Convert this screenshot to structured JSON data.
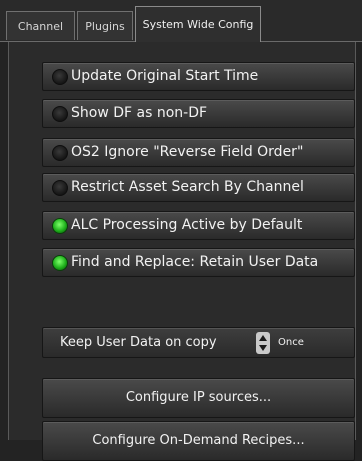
{
  "tabs": [
    {
      "label": "Channel"
    },
    {
      "label": "Plugins"
    },
    {
      "label": "System Wide Config"
    }
  ],
  "toggles": [
    {
      "label": "Update Original Start Time",
      "on": false
    },
    {
      "label": "Show DF as non-DF",
      "on": false
    },
    {
      "label": "OS2 Ignore \"Reverse Field Order\"",
      "on": false
    },
    {
      "label": "Restrict Asset Search By Channel",
      "on": false
    },
    {
      "label": "ALC Processing Active by Default",
      "on": true
    },
    {
      "label": "Find and Replace: Retain User Data",
      "on": true
    }
  ],
  "keep_user_data": {
    "label": "Keep User Data on copy",
    "value": "Once"
  },
  "buttons": {
    "configure_ip": "Configure IP sources...",
    "configure_recipes": "Configure On-Demand Recipes..."
  },
  "colors": {
    "led_on": "#22c01e",
    "led_off": "#1e1e1e",
    "background": "#232323"
  }
}
